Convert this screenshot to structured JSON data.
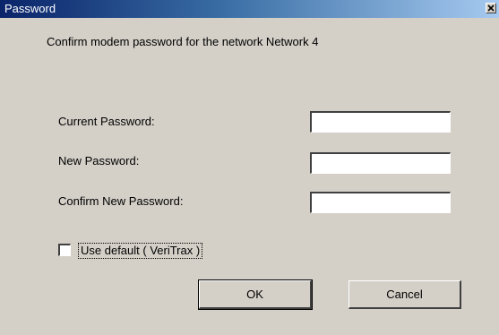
{
  "window": {
    "title": "Password",
    "close_icon": "close-icon"
  },
  "message": "Confirm modem password for the network Network 4",
  "fields": {
    "current_label": "Current Password:",
    "current_value": "",
    "new_label": "New Password:",
    "new_value": "",
    "confirm_label": "Confirm New Password:",
    "confirm_value": ""
  },
  "use_default": {
    "label": "Use default ( VeriTrax )",
    "checked": false
  },
  "buttons": {
    "ok_label": "OK",
    "cancel_label": "Cancel"
  },
  "colors": {
    "titlebar_start": "#0a246a",
    "titlebar_end": "#a6caf0",
    "face": "#d4d0c8"
  }
}
